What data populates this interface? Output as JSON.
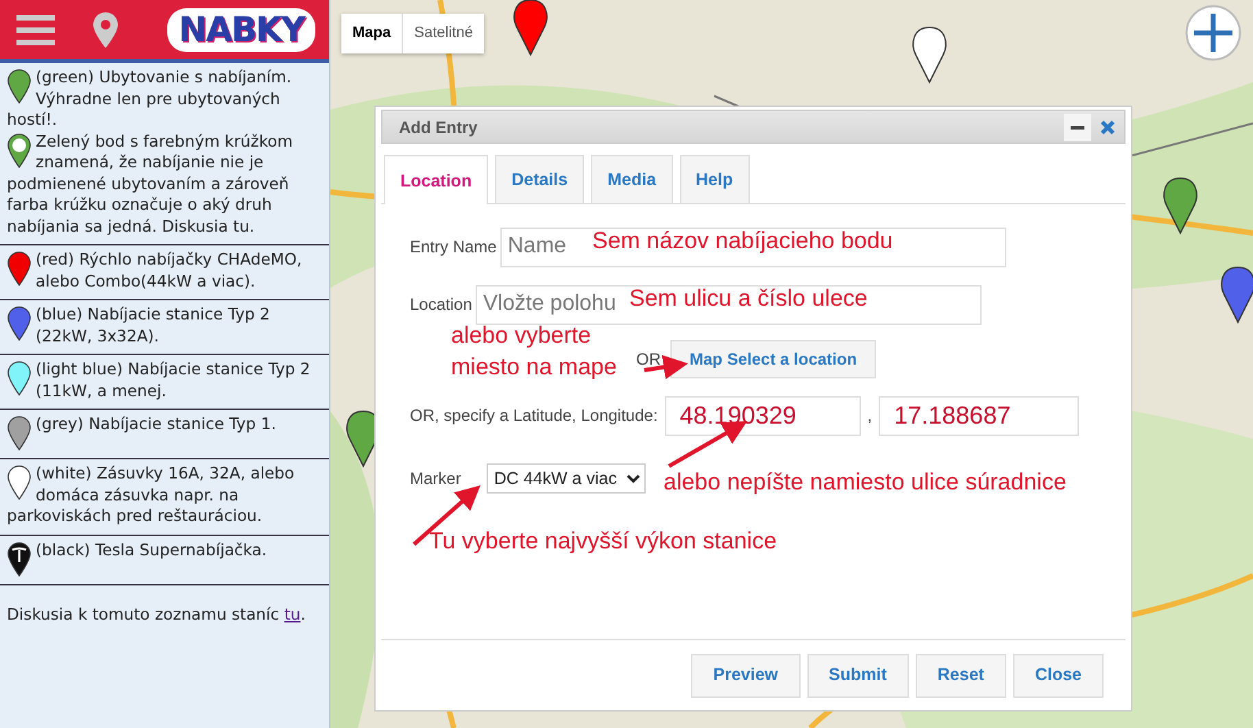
{
  "header": {
    "logo": "NABKY"
  },
  "legend": [
    {
      "entries": [
        {
          "kind": "pin",
          "color": "#5fa844",
          "text": "(green) Ubytovanie s nabíjaním. Výhradne len pre ubytovaných hostí!."
        },
        {
          "kind": "ring-pin",
          "color": "#5fa844",
          "text": "Zelený bod s farebným krúžkom znamená, že nabíjanie nie je podmienené ubytovaním a zároveň farba krúžku označuje o aký druh nabíjania sa jedná. Diskusia tu."
        }
      ]
    },
    {
      "entries": [
        {
          "kind": "pin",
          "color": "#f00000",
          "text": "(red) Rýchlo nabíjačky CHAdeMO, alebo Combo(44kW a viac)."
        }
      ]
    },
    {
      "entries": [
        {
          "kind": "pin",
          "color": "#5060e8",
          "text": "(blue) Nabíjacie stanice Typ 2 (22kW, 3x32A)."
        }
      ]
    },
    {
      "entries": [
        {
          "kind": "pin",
          "color": "#80f4f8",
          "text": "(light blue) Nabíjacie stanice Typ 2 (11kW, a menej."
        }
      ]
    },
    {
      "entries": [
        {
          "kind": "pin",
          "color": "#a0a0a0",
          "text": "(grey) Nabíjacie stanice Typ 1."
        }
      ]
    },
    {
      "entries": [
        {
          "kind": "pin",
          "color": "#ffffff",
          "text": "(white) Zásuvky 16A, 32A, alebo domáca zásuvka napr. na parkoviskách pred reštauráciou."
        }
      ]
    },
    {
      "entries": [
        {
          "kind": "tesla-pin",
          "color": "#111111",
          "text": "(black) Tesla Supernabíjačka."
        }
      ]
    }
  ],
  "footer_note": {
    "text": "Diskusia k tomuto zoznamu staníc ",
    "link": "tu",
    "end": "."
  },
  "map_types": [
    {
      "label": "Mapa",
      "selected": true
    },
    {
      "label": "Satelitné",
      "selected": false
    }
  ],
  "dialog": {
    "title": "Add Entry",
    "tabs": [
      {
        "label": "Location",
        "selected": true
      },
      {
        "label": "Details",
        "selected": false
      },
      {
        "label": "Media",
        "selected": false
      },
      {
        "label": "Help",
        "selected": false
      }
    ],
    "entry_name": {
      "label": "Entry Name",
      "placeholder": "Name"
    },
    "location": {
      "label": "Location",
      "placeholder": "Vložte polohu"
    },
    "or_label": "OR",
    "map_select_button": "Map Select a location",
    "coordinates": {
      "label": "OR, specify a Latitude, Longitude:",
      "latitude": "48.190329",
      "separator": ",",
      "longitude": "17.188687"
    },
    "marker": {
      "label": "Marker",
      "value": "DC 44kW a viac"
    },
    "buttons": [
      "Preview",
      "Submit",
      "Reset",
      "Close"
    ]
  },
  "annotations": [
    {
      "text": "Sem názov nabíjacieho bodu"
    },
    {
      "text": "Sem ulicu a číslo ulece"
    },
    {
      "text": "alebo vyberte miesto na mape"
    },
    {
      "text": "alebo nepíšte namiesto ulice súradnice"
    },
    {
      "text": "Tu vyberte najvyšší výkon stanice"
    }
  ]
}
